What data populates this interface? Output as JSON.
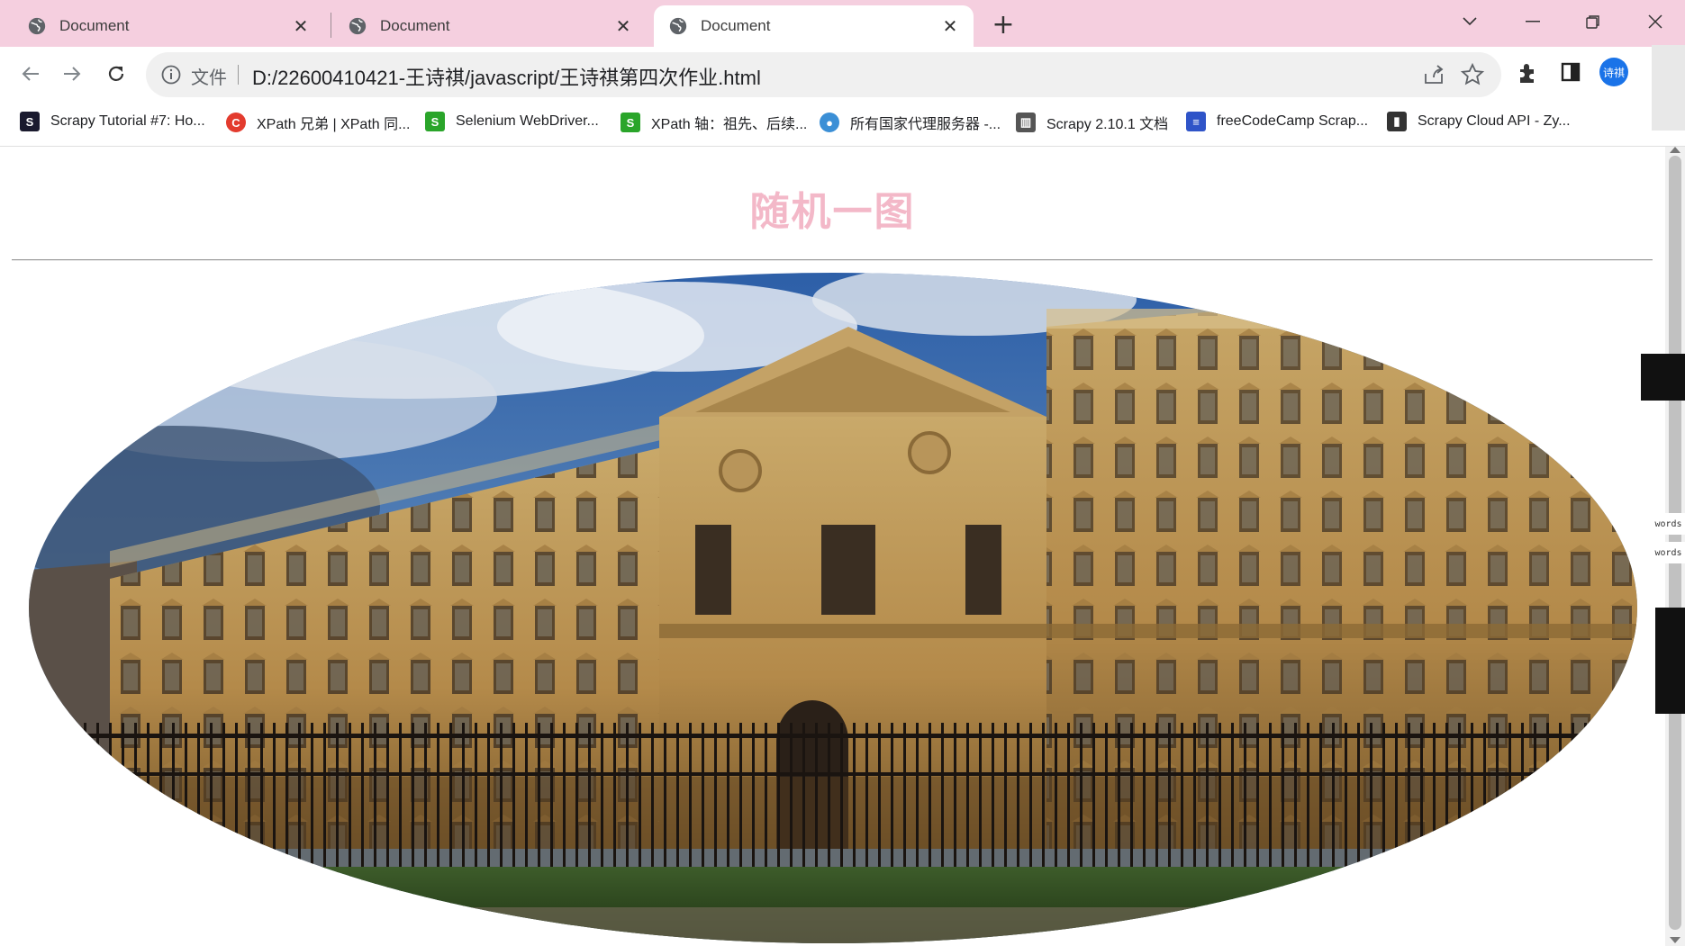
{
  "tabs": [
    {
      "title": "Document",
      "active": false
    },
    {
      "title": "Document",
      "active": false
    },
    {
      "title": "Document",
      "active": true
    }
  ],
  "address": {
    "scheme_label": "文件",
    "url": "D:/22600410421-王诗祺/javascript/王诗祺第四次作业.html"
  },
  "profile": {
    "initials": "诗祺"
  },
  "bookmarks": [
    {
      "label": "Scrapy Tutorial #7: Ho...",
      "icon": "scrapy-tutorial-icon",
      "color": "#1a1a2e",
      "glyph": "S"
    },
    {
      "label": "XPath 兄弟 | XPath 同...",
      "icon": "csdn-icon",
      "color": "#e33b2e",
      "glyph": "C"
    },
    {
      "label": "Selenium WebDriver...",
      "icon": "s-green-icon",
      "color": "#2aa52a",
      "glyph": "S"
    },
    {
      "label": "XPath 轴：祖先、后续...",
      "icon": "s-green-icon",
      "color": "#2aa52a",
      "glyph": "S"
    },
    {
      "label": "所有国家代理服务器 -...",
      "icon": "globe-earth-icon",
      "color": "#3b8fd6",
      "glyph": "●"
    },
    {
      "label": "Scrapy 2.10.1 文档",
      "icon": "docs-icon",
      "color": "#555555",
      "glyph": "▥"
    },
    {
      "label": "freeCodeCamp Scrap...",
      "icon": "freecodecamp-icon",
      "color": "#2f54c8",
      "glyph": "≡"
    },
    {
      "label": "Scrapy Cloud API - Zy...",
      "icon": "zyte-icon",
      "color": "#333333",
      "glyph": "▮"
    }
  ],
  "page": {
    "heading": "随机一图",
    "heading_color": "#f3b8c8",
    "image_subject": "Louvre colonnade facade under cloudy blue sky, clipped to oval"
  },
  "side_words": [
    "words",
    "words"
  ]
}
